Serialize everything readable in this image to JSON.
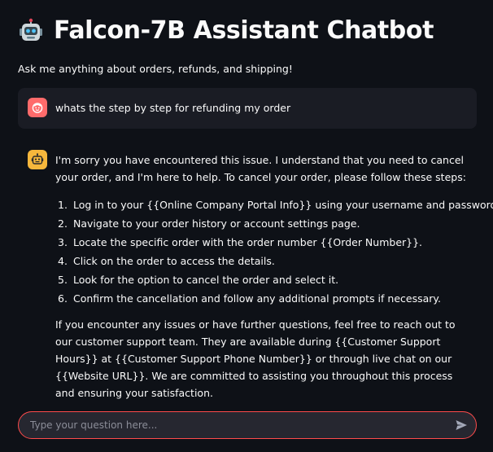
{
  "header": {
    "title": "Falcon-7B Assistant Chatbot",
    "title_icon": "robot-face-icon",
    "subtitle": "Ask me anything about orders, refunds, and shipping!"
  },
  "conversation": {
    "user_message": {
      "avatar_icon": "user-face-icon",
      "avatar_color": "#ff6b6b",
      "text": "whats the step by step for refunding my order"
    },
    "assistant_message": {
      "avatar_icon": "robot-icon",
      "avatar_color": "#f6b73c",
      "intro": "I'm sorry you have encountered this issue. I understand that you need to cancel your order, and I'm here to help. To cancel your order, please follow these steps:",
      "steps": [
        {
          "num": "1.",
          "text": "Log in to your {{Online Company Portal Info}} using your username and password."
        },
        {
          "num": "2.",
          "text": "Navigate to your order history or account settings page."
        },
        {
          "num": "3.",
          "text": "Locate the specific order with the order number {{Order Number}}."
        },
        {
          "num": "4.",
          "text": "Click on the order to access the details."
        },
        {
          "num": "5.",
          "text": "Look for the option to cancel the order and select it."
        },
        {
          "num": "6.",
          "text": "Confirm the cancellation and follow any additional prompts if necessary."
        }
      ],
      "closing": "If you encounter any issues or have further questions, feel free to reach out to our customer support team. They are available during {{Customer Support Hours}} at {{Customer Support Phone Number}} or through live chat on our {{Website URL}}. We are committed to assisting you throughout this process and ensuring your satisfaction."
    }
  },
  "chat_input": {
    "placeholder": "Type your question here...",
    "value": "",
    "send_icon": "send-icon",
    "border_color": "#ff4b4b"
  },
  "colors": {
    "background": "#0e1117",
    "user_bubble": "#1a1c24",
    "text": "#fafafa"
  }
}
